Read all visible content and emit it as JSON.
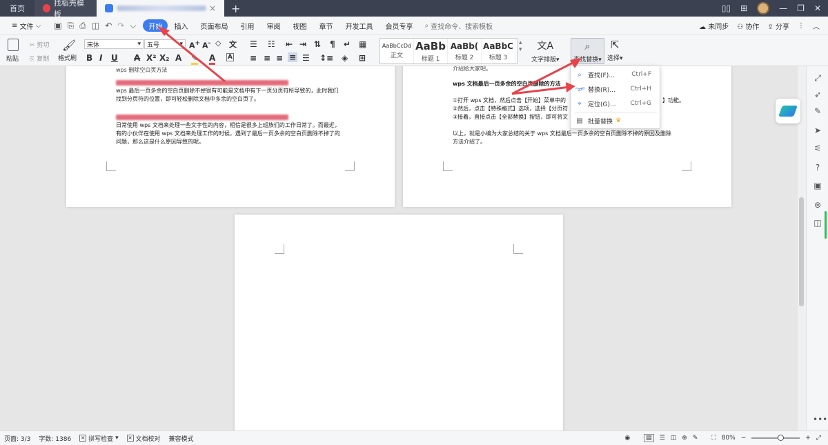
{
  "tabs": {
    "home": "首页",
    "template": "找稻壳模板",
    "add": "+"
  },
  "menu": {
    "file": "文件",
    "items": [
      "开始",
      "插入",
      "页面布局",
      "引用",
      "审阅",
      "视图",
      "章节",
      "开发工具",
      "会员专享"
    ],
    "search_placeholder": "查找命令、搜索模板",
    "unsynced": "未同步",
    "collaborate": "协作",
    "share": "分享"
  },
  "ribbon": {
    "paste": "粘贴",
    "cut": "剪切",
    "copy": "复制",
    "format_painter": "格式刷",
    "font_name": "宋体",
    "font_size": "五号",
    "styles": [
      {
        "sample": "AaBbCcDd",
        "name": "正文"
      },
      {
        "sample": "AaBb",
        "name": "标题 1"
      },
      {
        "sample": "AaBb(",
        "name": "标题 2"
      },
      {
        "sample": "AaBbC",
        "name": "标题 3"
      }
    ],
    "text_layout": "文字排版",
    "find_replace": "查找替换",
    "select": "选择"
  },
  "dropdown": {
    "find": {
      "label": "查找(F)...",
      "shortcut": "Ctrl+F"
    },
    "replace": {
      "label": "替换(R)...",
      "shortcut": "Ctrl+H"
    },
    "goto": {
      "label": "定位(G)...",
      "shortcut": "Ctrl+G"
    },
    "batch_replace": "批量替换"
  },
  "page1": {
    "line_top": "wps 删除空白页方法",
    "para1_line1": "wps 最后一页多余的空白页删除不掉很有可能是文档中有下一页分页符所导致的，此时我们",
    "para1_line2": "找到分页符的位置，即可轻松删除文档中多余的空白页了。",
    "para2_line1": "日常使用 wps 文档来处理一些文字性的内容，相信是很多上班族们的工作日常了。而最近，",
    "para2_line2": "有的小伙伴在使用 wps 文档来处理工作的时候，遇到了最后一页多余的空白页删除不掉了的",
    "para2_line3": "问题，那么这是什么原因导致的呢。"
  },
  "page2": {
    "line_top": "介绍给大家吧。",
    "heading": "wps 文档最后一页多余的空白页删除的方法",
    "step1": "①打开 wps 文档，然后点击【开始】菜单中的",
    "step1_end": "】功能。",
    "step2": "②然后，点击【特殊格式】选项，选择【分页符",
    "step3": "③接着，直接点击【全部替换】按钮，即可将文",
    "summary_line1": "以上，就是小编为大家总结的关于 wps 文档最后一页多余的空白页删除不掉的原因及删除",
    "summary_line2": "方法介绍了。"
  },
  "status": {
    "page": "页面: 3/3",
    "words": "字数: 1386",
    "spellcheck": "拼写检查",
    "proofread": "文档校对",
    "compat": "兼容模式",
    "zoom": "80%"
  },
  "colors": {
    "accent": "#3d7cf0",
    "tabbar": "#3b4151",
    "arrow": "#e8434a"
  }
}
